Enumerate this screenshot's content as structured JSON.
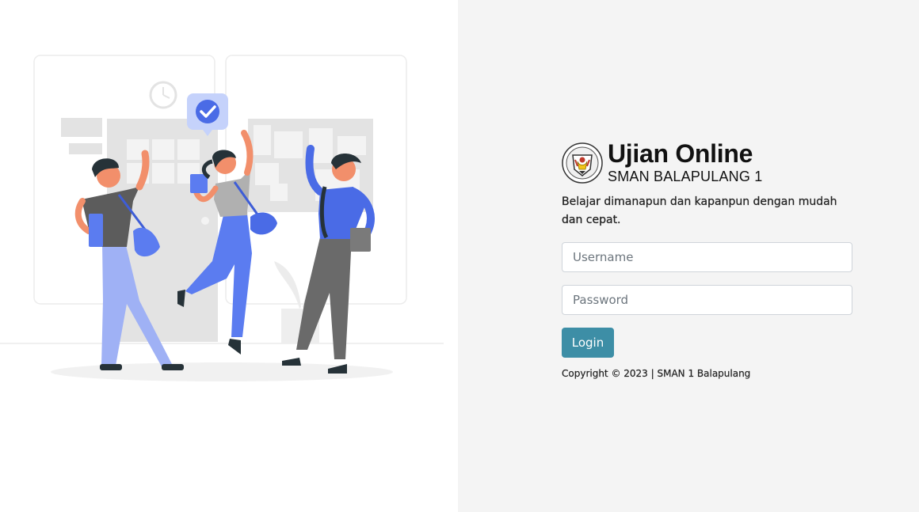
{
  "brand": {
    "title": "Ujian Online",
    "subtitle": "SMAN BALAPULANG 1",
    "logo_icon": "school-emblem-icon"
  },
  "tagline": "Belajar dimanapun dan kapanpun dengan mudah dan cepat.",
  "form": {
    "username_placeholder": "Username",
    "username_value": "",
    "password_placeholder": "Password",
    "password_value": "",
    "login_label": "Login"
  },
  "footer": {
    "copyright": "Copyright © 2023 | SMAN 1 Balapulang"
  },
  "illustration": {
    "name": "students-celebrating-illustration",
    "check_icon": "check-bubble-icon"
  },
  "colors": {
    "accent": "#3d8ea6",
    "panel_bg": "#f4f4f4",
    "illustration_blue": "#5b7cf0"
  }
}
